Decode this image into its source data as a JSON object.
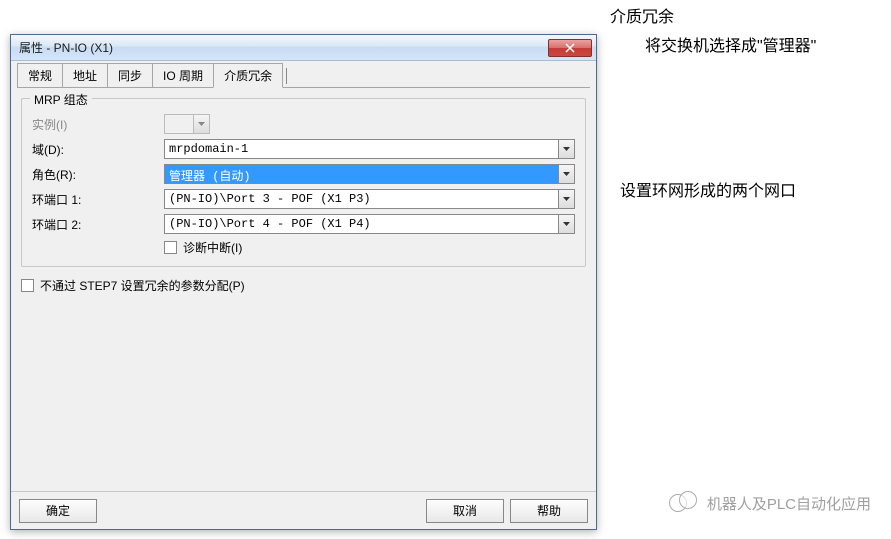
{
  "dialog": {
    "title": "属性 - PN-IO (X1)"
  },
  "tabs": {
    "t1": "常规",
    "t2": "地址",
    "t3": "同步",
    "t4": "IO 周期",
    "t5": "介质冗余"
  },
  "group": {
    "title": "MRP 组态",
    "labels": {
      "instance": "实例(I)",
      "domain": "域(D):",
      "role": "角色(R):",
      "port1": "环端口 1:",
      "port2": "环端口 2:"
    },
    "values": {
      "domain": "mrpdomain-1",
      "role": "管理器 (自动)",
      "port1": "(PN-IO)\\Port 3 - POF (X1 P3)",
      "port2": "(PN-IO)\\Port 4 - POF (X1 P4)"
    },
    "diag_interrupt": "诊断中断(I)"
  },
  "checkbox_step7": "不通过 STEP7 设置冗余的参数分配(P)",
  "buttons": {
    "ok": "确定",
    "cancel": "取消",
    "help": "帮助"
  },
  "annotations": {
    "a1": "介质冗余",
    "a2": "将交换机选择成\"管理器\"",
    "a3": "设置环网形成的两个网口"
  },
  "watermark": "机器人及PLC自动化应用"
}
